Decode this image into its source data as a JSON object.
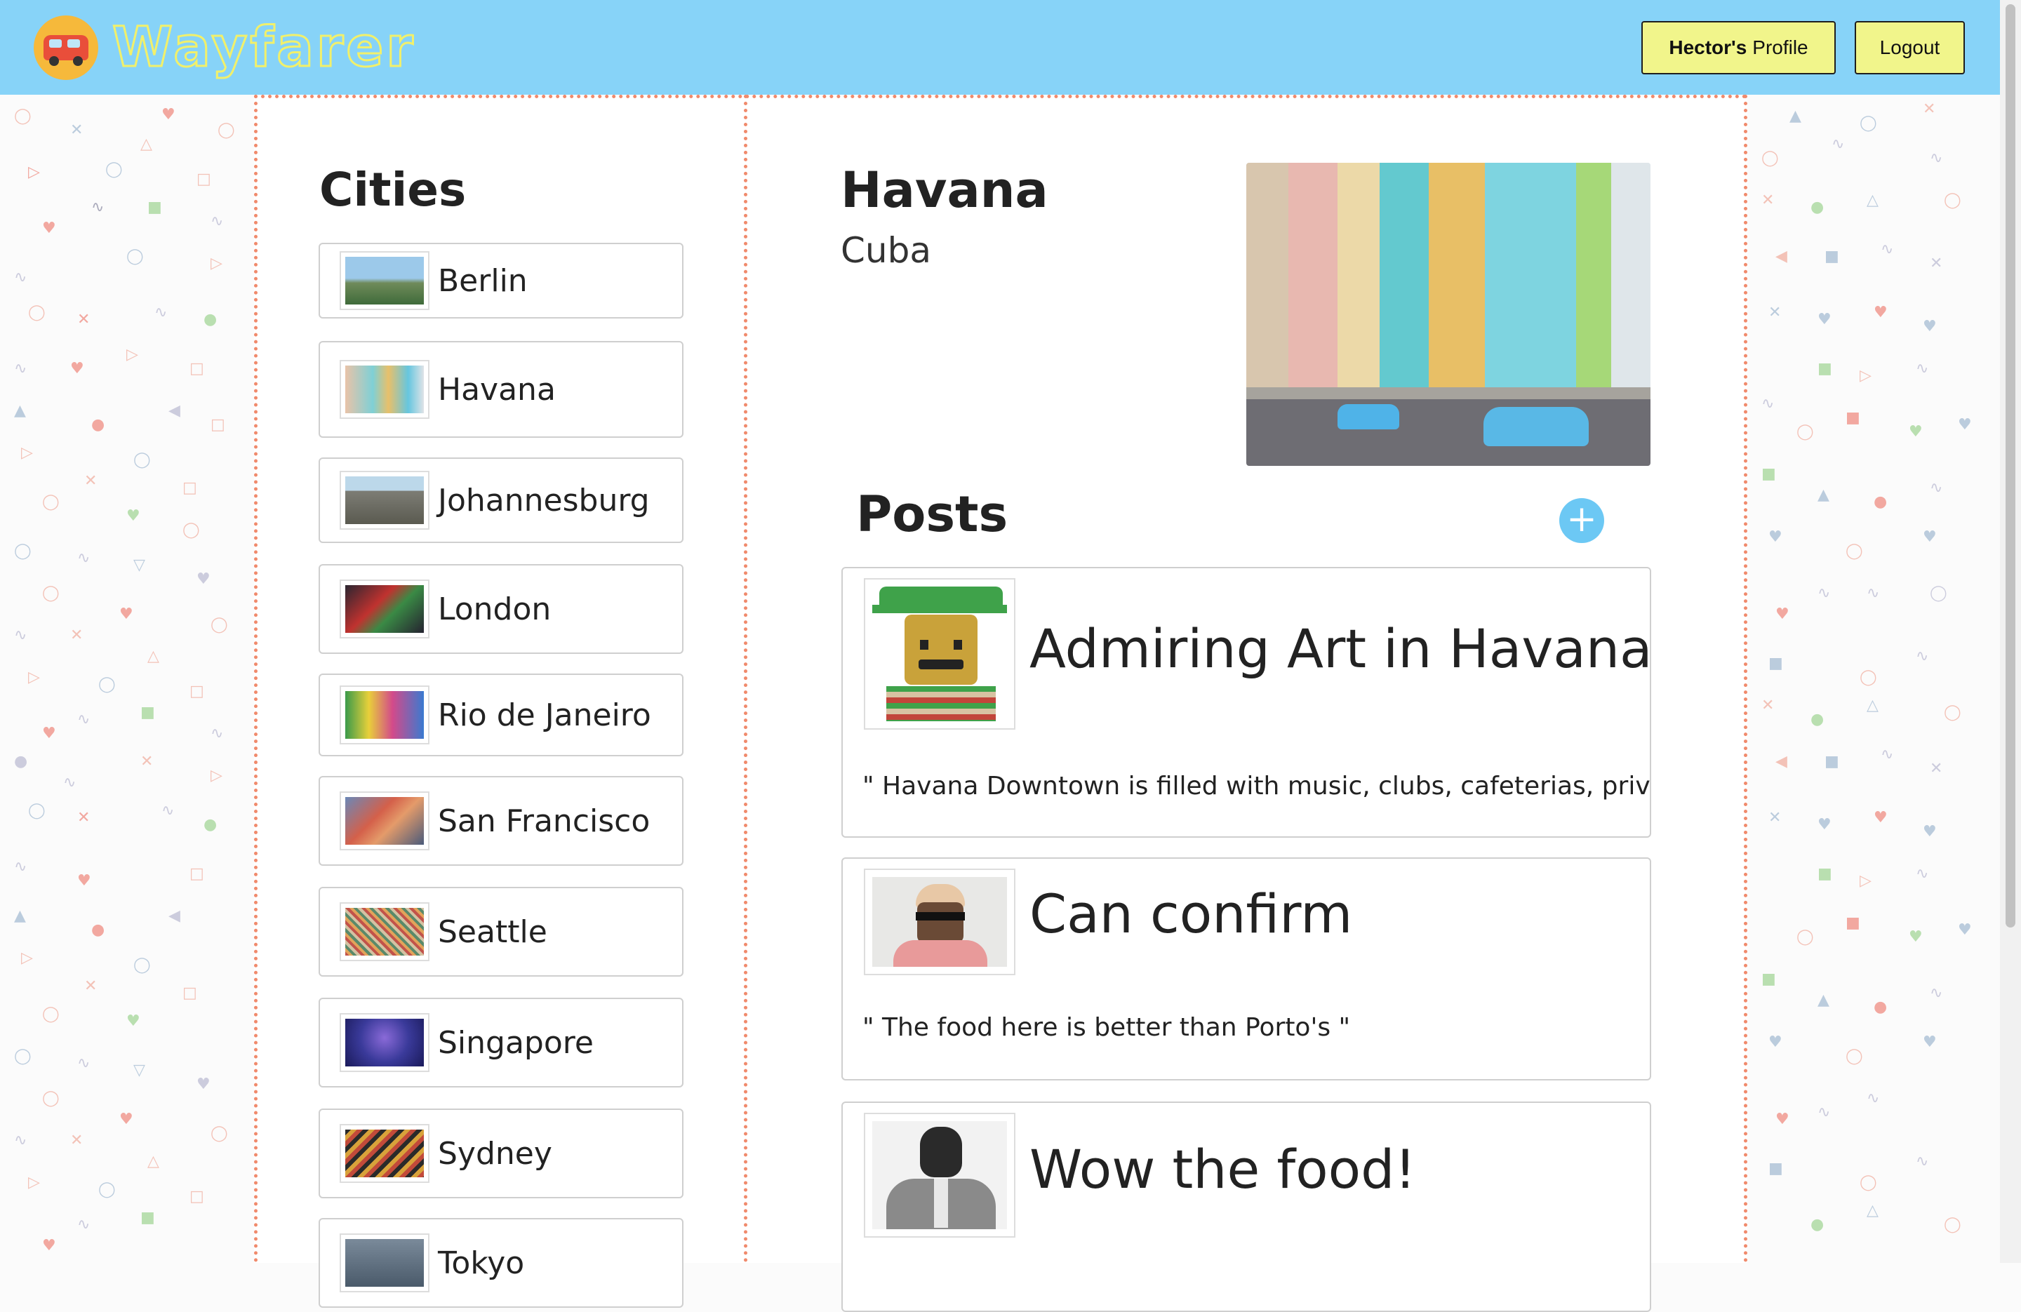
{
  "brand": {
    "name": "Wayfarer",
    "logo_icon": "van-icon"
  },
  "header": {
    "profile_user": "Hector's",
    "profile_label": "Profile",
    "logout_label": "Logout"
  },
  "colors": {
    "header_bg": "#87d3f8",
    "button_bg": "#f1f58b",
    "dotted_border": "#f08a6c",
    "add_button": "#6cc8f4"
  },
  "cities": {
    "title": "Cities",
    "items": [
      {
        "name": "Berlin"
      },
      {
        "name": "Havana"
      },
      {
        "name": "Johannesburg"
      },
      {
        "name": "London"
      },
      {
        "name": "Rio de Janeiro"
      },
      {
        "name": "San Francisco"
      },
      {
        "name": "Seattle"
      },
      {
        "name": "Singapore"
      },
      {
        "name": "Sydney"
      },
      {
        "name": "Tokyo"
      }
    ]
  },
  "city_detail": {
    "name": "Havana",
    "country": "Cuba"
  },
  "posts": {
    "title": "Posts",
    "add_icon": "plus-icon",
    "items": [
      {
        "title": "Admiring Art in Havana",
        "body": "\" Havana Downtown is filled with music, clubs, cafeterias, private restau"
      },
      {
        "title": "Can confirm",
        "body": "\" The food here is better than Porto's \""
      },
      {
        "title": "Wow the food!",
        "body": ""
      }
    ]
  }
}
